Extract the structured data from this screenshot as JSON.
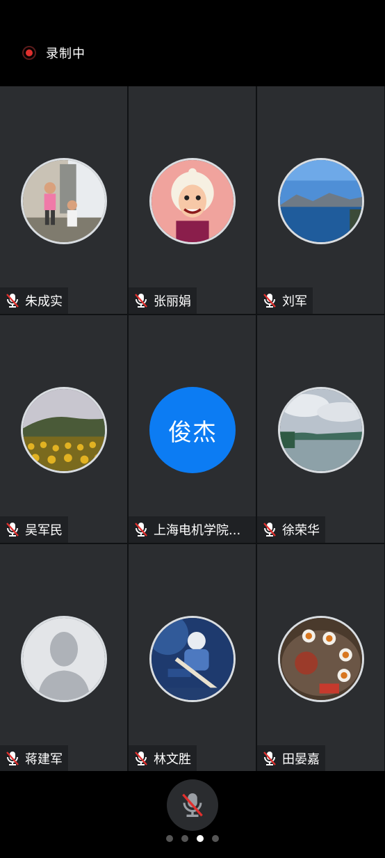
{
  "recording": {
    "label": "录制中",
    "color": "#e0302e"
  },
  "participants": [
    {
      "name": "朱成实",
      "avatar": "kids-photo"
    },
    {
      "name": "张丽娟",
      "avatar": "cartoon-grandma"
    },
    {
      "name": "刘军",
      "avatar": "lake-photo"
    },
    {
      "name": "吴军民",
      "avatar": "sunflower-field"
    },
    {
      "name": "上海电机学院...",
      "avatar": "initials",
      "initials": "俊杰"
    },
    {
      "name": "徐荣华",
      "avatar": "cloudy-lake"
    },
    {
      "name": "蒋建军",
      "avatar": "default-person"
    },
    {
      "name": "林文胜",
      "avatar": "hockey-player"
    },
    {
      "name": "田晏嘉",
      "avatar": "tea-set"
    }
  ],
  "controls": {
    "mic_state": "muted",
    "page_indicator": {
      "total": 4,
      "current": 3
    }
  },
  "colors": {
    "tile_bg": "#2b2d30",
    "initials_bg": "#0c7cf3",
    "mute_red": "#e0302e"
  }
}
